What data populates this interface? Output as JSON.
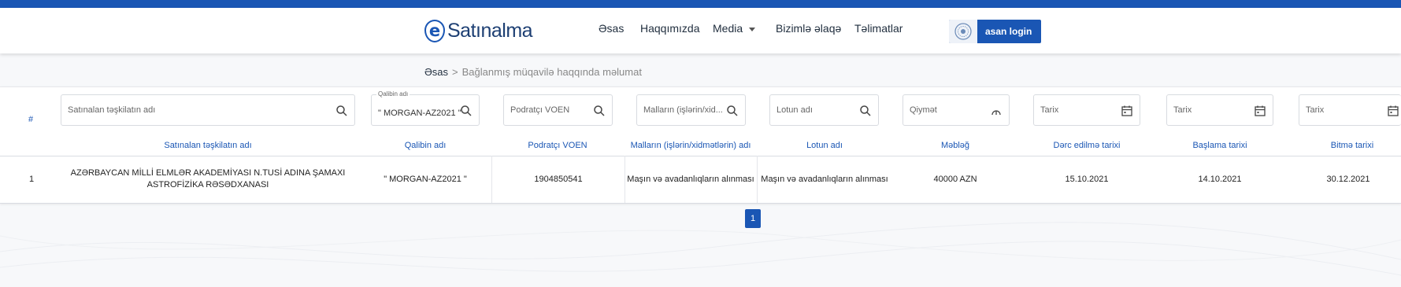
{
  "header": {
    "logo_text": "Satınalma",
    "logo_letter": "e",
    "nav": [
      "Əsas",
      "Haqqımızda",
      "Media",
      "Bizimlə əlaqə",
      "Təlimatlar"
    ],
    "login_label": "asan login"
  },
  "breadcrumb": {
    "home": "Əsas",
    "separator": ">",
    "current": "Bağlanmış müqavilə haqqında məlumat"
  },
  "filters": {
    "org_placeholder": "Satınalan təşkilatın adı",
    "template_label": "Qalibin adı",
    "template_value": "\" MORGAN-AZ2021 \"",
    "voen_placeholder": "Podratçı VOEN",
    "goods_placeholder": "Malların (işlərin/xid...",
    "lot_placeholder": "Lotun adı",
    "price_placeholder": "Qiymət",
    "date1_placeholder": "Tarix",
    "date2_placeholder": "Tarix",
    "date3_placeholder": "Tarix"
  },
  "table": {
    "hash": "#",
    "columns": [
      "Satınalan təşkilatın adı",
      "Qalibin adı",
      "Podratçı VOEN",
      "Malların (işlərin/xidmətlərin) adı",
      "Lotun adı",
      "Məbləğ",
      "Dərc edilmə tarixi",
      "Başlama tarixi",
      "Bitmə tarixi"
    ],
    "rows": [
      {
        "index": "1",
        "org": "AZƏRBAYCAN MİLLİ ELMLƏR AKADEMİYASI N.TUSİ ADINA ŞAMAXI ASTROFİZİKA RƏSƏDXANASI",
        "winner": "\" MORGAN-AZ2021 \"",
        "voen": "1904850541",
        "goods": "Maşın və avadanlıqların alınması",
        "lot": "Maşın və avadanlıqların alınması",
        "amount": "40000 AZN",
        "published": "15.10.2021",
        "start": "14.10.2021",
        "end": "30.12.2021"
      }
    ]
  },
  "pagination": {
    "current": "1"
  },
  "colors": {
    "primary": "#1a56b4",
    "dark_text": "#1f2d3d"
  }
}
